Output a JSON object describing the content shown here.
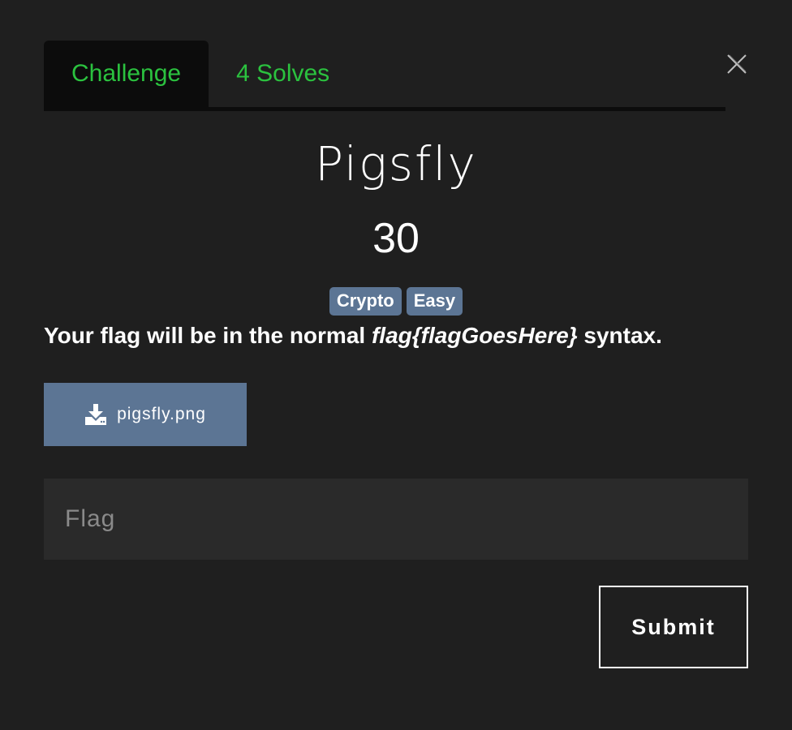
{
  "tabs": [
    {
      "label": "Challenge"
    },
    {
      "label": "4 Solves"
    }
  ],
  "challenge": {
    "name": "Pigsfly",
    "points": "30",
    "tags": [
      "Crypto",
      "Easy"
    ],
    "description_prefix": "Your flag will be in the normal ",
    "description_emphasis": "flag{flagGoesHere}",
    "description_suffix": " syntax."
  },
  "file": {
    "icon": "download-icon",
    "name": "pigsfly.png"
  },
  "flag_input": {
    "placeholder": "Flag",
    "value": ""
  },
  "submit_label": "Submit",
  "colors": {
    "background": "#1f1f1f",
    "tab_active_bg": "#0c0c0c",
    "accent_green": "#2bc23f",
    "tag_blue": "#5c7594",
    "input_bg": "#2a2a2a"
  }
}
